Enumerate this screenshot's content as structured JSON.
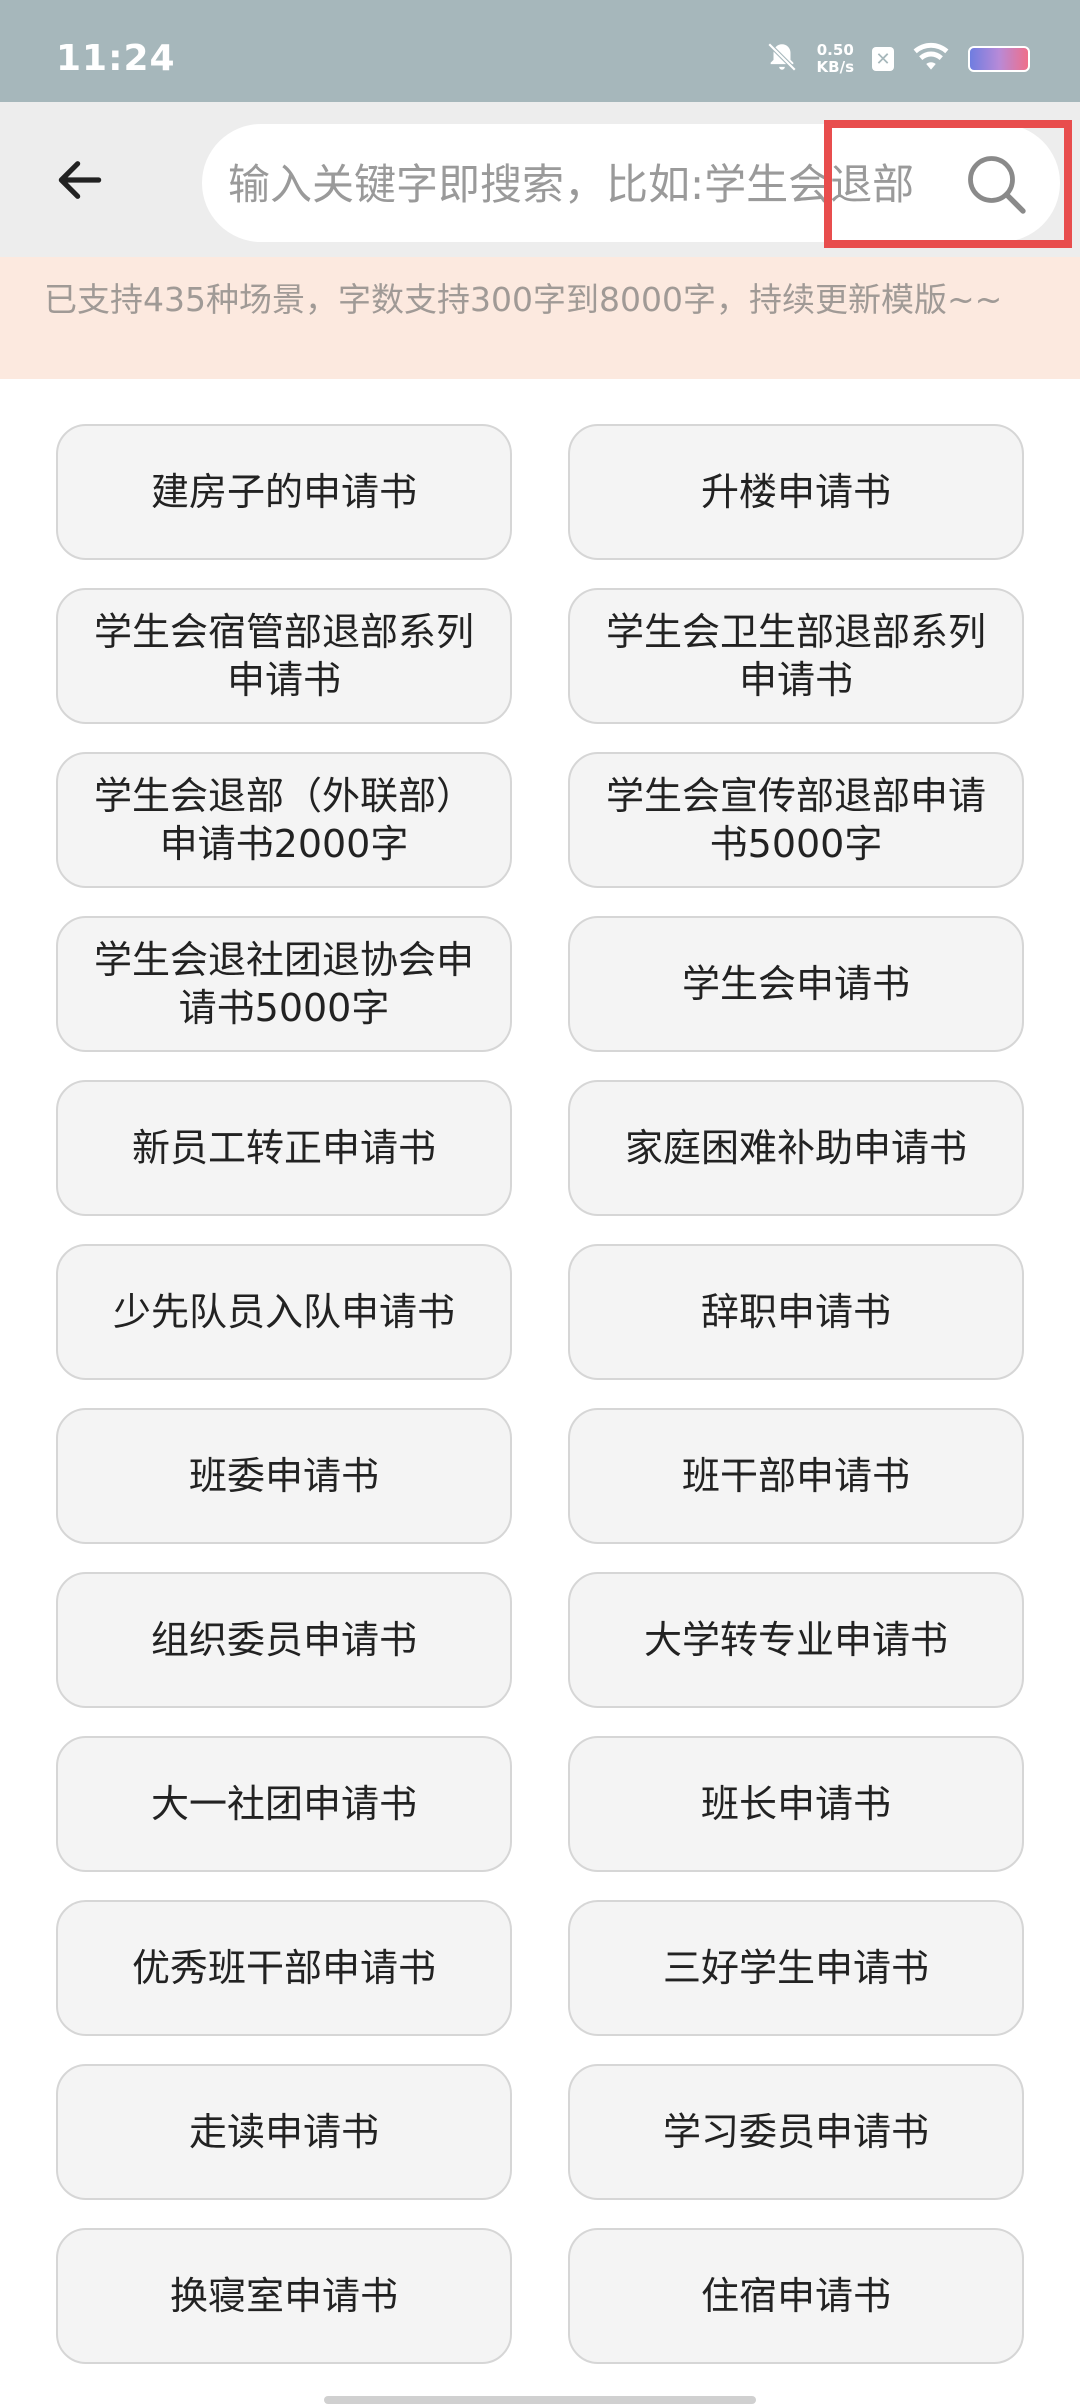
{
  "status_bar": {
    "time": "11:24",
    "net_speed_value": "0.50",
    "net_speed_unit": "KB/s",
    "icons": [
      "bell-off-icon",
      "x-box-icon",
      "wifi-icon",
      "battery-icon"
    ]
  },
  "toolbar": {
    "back_icon": "arrow-left-icon",
    "search_placeholder": "输入关键字即搜索，比如:学生会退部",
    "search_icon": "search-icon",
    "highlight_color": "#e84d4d"
  },
  "notice": {
    "text": "已支持435种场景，字数支持300字到8000字，持续更新模版~~"
  },
  "templates": [
    "建房子的申请书",
    "升楼申请书",
    "学生会宿管部退部系列申请书",
    "学生会卫生部退部系列申请书",
    "学生会退部（外联部）申请书2000字",
    "学生会宣传部退部申请书5000字",
    "学生会退社团退协会申请书5000字",
    "学生会申请书",
    "新员工转正申请书",
    "家庭困难补助申请书",
    "少先队员入队申请书",
    "辞职申请书",
    "班委申请书",
    "班干部申请书",
    "组织委员申请书",
    "大学转专业申请书",
    "大一社团申请书",
    "班长申请书",
    "优秀班干部申请书",
    "三好学生申请书",
    "走读申请书",
    "学习委员申请书",
    "换寝室申请书",
    "住宿申请书"
  ]
}
